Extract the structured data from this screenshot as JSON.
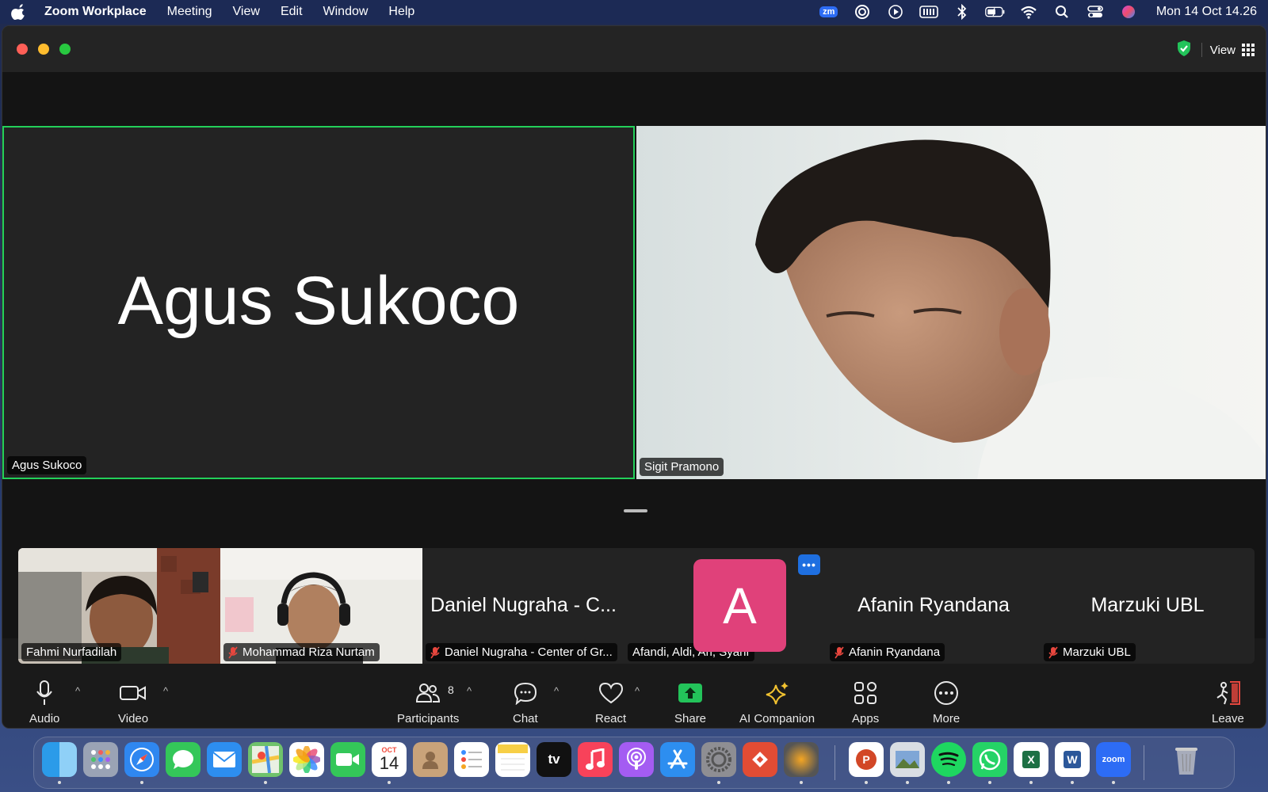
{
  "menubar": {
    "app_name": "Zoom Workplace",
    "menus": [
      "Meeting",
      "View",
      "Edit",
      "Window",
      "Help"
    ],
    "status_icons": [
      "zoom-status-icon",
      "focus-icon",
      "play-icon",
      "battery-menu-icon",
      "bluetooth-icon",
      "battery-icon",
      "wifi-icon",
      "spotlight-icon",
      "control-center-icon",
      "siri-icon"
    ],
    "zoom_badge": "zm",
    "clock": "Mon 14 Oct  14.26"
  },
  "window": {
    "view_label": "View"
  },
  "main_tiles": {
    "agus": {
      "display_name": "Agus Sukoco",
      "tag": "Agus Sukoco"
    },
    "sigit": {
      "tag": "Sigit Pramono"
    }
  },
  "strip": {
    "fahmi": {
      "tag": "Fahmi Nurfadilah"
    },
    "riza": {
      "tag": "Mohammad Riza Nurtam"
    },
    "daniel": {
      "center": "Daniel Nugraha - C...",
      "tag": "Daniel Nugraha - Center of Gr..."
    },
    "afandi": {
      "avatar": "A",
      "tag": "Afandi, Aldi, Ari, Syarif",
      "more": "•••"
    },
    "afanin": {
      "center": "Afanin Ryandana",
      "tag": "Afanin Ryandana"
    },
    "marzuki": {
      "center": "Marzuki UBL",
      "tag": "Marzuki UBL"
    }
  },
  "toolbar": {
    "audio": "Audio",
    "video": "Video",
    "participants": "Participants",
    "participants_count": "8",
    "chat": "Chat",
    "react": "React",
    "share": "Share",
    "ai_companion": "AI Companion",
    "apps": "Apps",
    "more": "More",
    "leave": "Leave",
    "caret": "^"
  },
  "dock": {
    "calendar_month": "OCT",
    "calendar_day": "14",
    "tv_label": "tv",
    "zoom_label": "zoom",
    "excel_label": "X",
    "word_label": "W",
    "ppt_label": "P"
  }
}
